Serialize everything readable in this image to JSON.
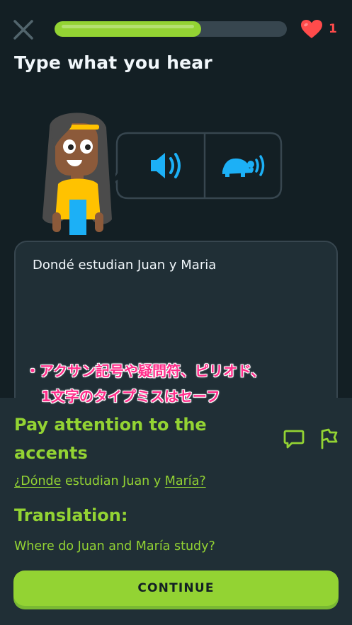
{
  "header": {
    "close_icon": "close-icon",
    "progress_fraction": 0.63,
    "hearts_icon": "heart-icon",
    "hearts_count": "1"
  },
  "prompt": {
    "title": "Type what you hear",
    "audio_normal_icon": "speaker-icon",
    "audio_slow_icon": "turtle-speaker-icon"
  },
  "answer": {
    "text": "Dondé estudian Juan y Maria"
  },
  "annotation": {
    "line1": "・アクサン記号や疑問符、ピリオド、",
    "line2": "1文字のタイプミスはセーフ"
  },
  "feedback": {
    "heading_line1": "Pay attention to the",
    "heading_line2": "accents",
    "correct_parts": [
      {
        "text": "¿Dónde",
        "underline": true
      },
      {
        "text": " estudian Juan y ",
        "underline": false
      },
      {
        "text": "María?",
        "underline": true
      }
    ],
    "translation_label": "Translation:",
    "translation_text": "Where do Juan and María study?",
    "comment_icon": "comment-icon",
    "flag_icon": "flag-icon",
    "continue_label": "CONTINUE"
  },
  "colors": {
    "background": "#131f24",
    "panel": "#202f36",
    "accent_green": "#93d333",
    "audio_blue": "#1cb0f6",
    "heart_red": "#ff4b4b",
    "annotation_pink": "#ff2d8a"
  }
}
